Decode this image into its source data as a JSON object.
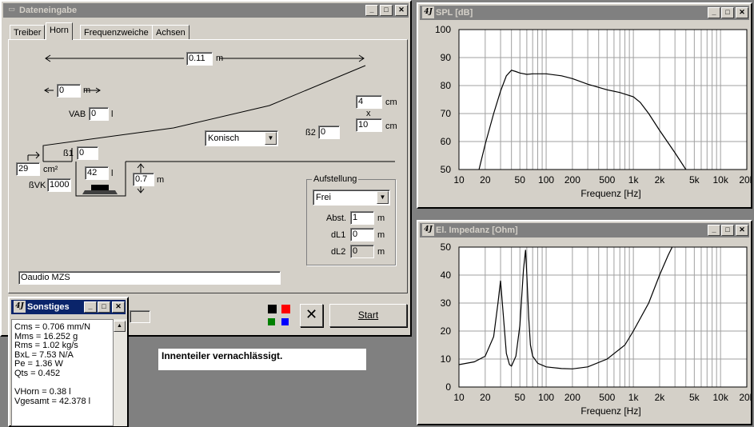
{
  "main": {
    "title": "Dateneingabe",
    "tabs": [
      "Treiber",
      "Horn",
      "Frequenzweiche",
      "Achsen"
    ],
    "active_tab": "Horn",
    "length_value": "0.11",
    "length_unit": "m",
    "offset_value": "0",
    "offset_unit": "m",
    "vab_label": "VAB",
    "vab_value": "0",
    "vab_unit": "l",
    "beta1_label": "ß1",
    "beta1_value": "0",
    "beta2_label": "ß2",
    "beta2_value": "0",
    "mouth_w_value": "4",
    "mouth_w_unit": "cm",
    "mouth_x": "x",
    "mouth_h_value": "10",
    "mouth_h_unit": "cm",
    "horn_type": "Konisch",
    "throat_area_value": "29",
    "throat_area_unit": "cm²",
    "bvk_label": "ßVK",
    "bvk_value": "1000",
    "volume_value": "42",
    "volume_unit": "l",
    "depth_value": "0.7",
    "depth_unit": "m",
    "aufstellung": {
      "label": "Aufstellung",
      "mode": "Frei",
      "abst_label": "Abst.",
      "abst_value": "1",
      "dl1_label": "dL1",
      "dl1_value": "0",
      "dl2_label": "dL2",
      "dl2_value": "0",
      "unit": "m"
    },
    "driver_name": "Oaudio MZS",
    "start_label": "Start",
    "colors": [
      "#000000",
      "#ff0000",
      "#008000",
      "#0000ff"
    ]
  },
  "status_message": "Innenteiler vernachlässigt.",
  "sonstiges": {
    "title": "Sonstiges",
    "lines": [
      "Cms = 0.706 mm/N",
      "Mms = 16.252 g",
      "Rms = 1.02 kg/s",
      "BxL = 7.53 N/A",
      "Pe = 1.36 W",
      "Qts = 0.452",
      "",
      "VHorn = 0.38 l",
      "Vgesamt = 42.378 l"
    ]
  },
  "spl_window": {
    "title": "SPL [dB]"
  },
  "imp_window": {
    "title": "El. Impedanz [Ohm]"
  },
  "chart_data": [
    {
      "type": "line",
      "title": "SPL [dB]",
      "xlabel": "Frequenz [Hz]",
      "ylabel": "",
      "xscale": "log",
      "xlim": [
        10,
        20000
      ],
      "ylim": [
        50,
        100
      ],
      "xticks": [
        10,
        20,
        50,
        100,
        200,
        500,
        1000,
        2000,
        5000,
        10000,
        20000
      ],
      "xticklabels": [
        "10",
        "20",
        "50",
        "100",
        "200",
        "500",
        "1k",
        "2k",
        "5k",
        "10k",
        "20k"
      ],
      "yticks": [
        50,
        60,
        70,
        80,
        90,
        100
      ],
      "grid": true,
      "series": [
        {
          "x": [
            17,
            20,
            25,
            30,
            35,
            40,
            45,
            50,
            60,
            70,
            80,
            100,
            150,
            200,
            300,
            500,
            700,
            1000,
            1200,
            1500,
            2000,
            3000,
            4000
          ],
          "y": [
            50,
            59,
            70,
            78,
            83.5,
            85.5,
            85,
            84.5,
            84,
            84.2,
            84.2,
            84.2,
            83.5,
            82.5,
            80.5,
            78.5,
            77.5,
            76,
            74,
            70,
            64,
            56,
            50
          ]
        }
      ]
    },
    {
      "type": "line",
      "title": "El. Impedanz [Ohm]",
      "xlabel": "Frequenz [Hz]",
      "ylabel": "",
      "xscale": "log",
      "xlim": [
        10,
        20000
      ],
      "ylim": [
        0,
        50
      ],
      "xticks": [
        10,
        20,
        50,
        100,
        200,
        500,
        1000,
        2000,
        5000,
        10000,
        20000
      ],
      "xticklabels": [
        "10",
        "20",
        "50",
        "100",
        "200",
        "500",
        "1k",
        "2k",
        "5k",
        "10k",
        "20k"
      ],
      "yticks": [
        0,
        10,
        20,
        30,
        40,
        50
      ],
      "grid": true,
      "series": [
        {
          "x": [
            10,
            15,
            20,
            25,
            28,
            30,
            32,
            35,
            38,
            40,
            45,
            50,
            55,
            58,
            60,
            63,
            66,
            70,
            80,
            100,
            150,
            200,
            300,
            500,
            800,
            1000,
            1500,
            2000,
            2500,
            3000
          ],
          "y": [
            8,
            9,
            11,
            18,
            30,
            38,
            27,
            12,
            8,
            7.5,
            11,
            22,
            42,
            49,
            40,
            25,
            15,
            11,
            8.5,
            7.2,
            6.6,
            6.5,
            7.2,
            10,
            15,
            20,
            30,
            40,
            47,
            52
          ]
        }
      ]
    }
  ]
}
